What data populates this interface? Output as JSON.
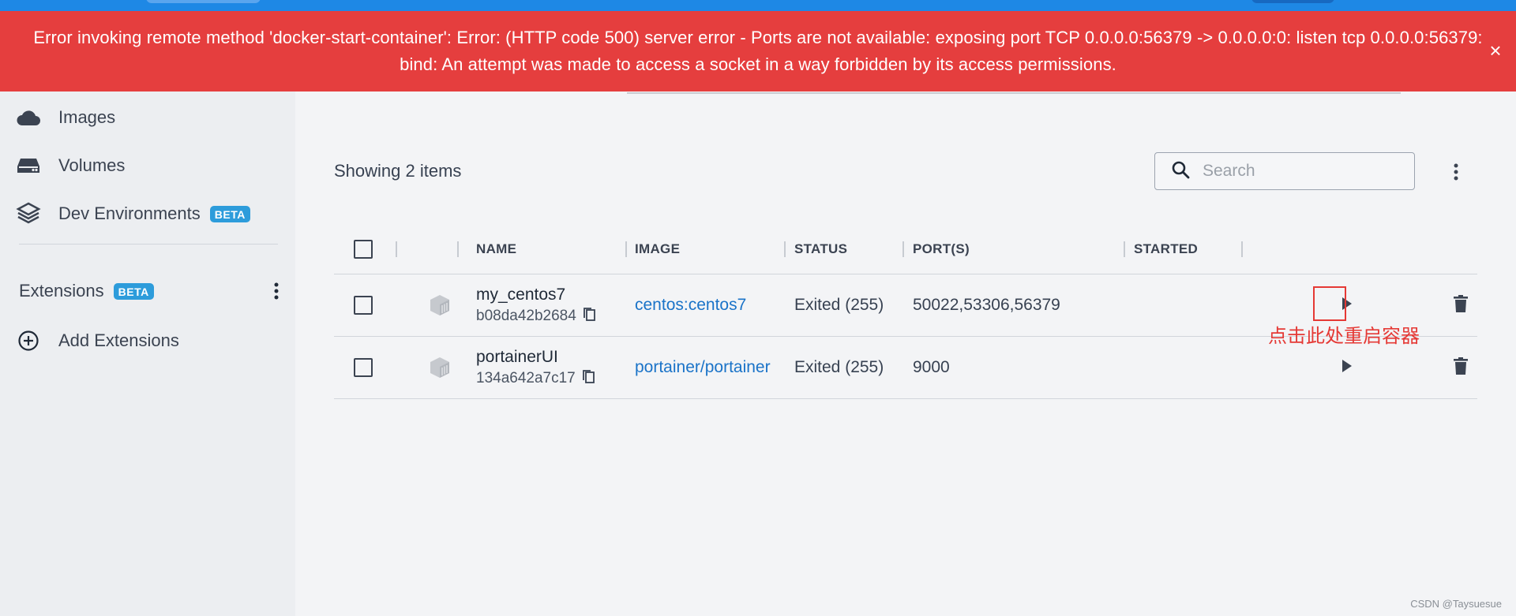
{
  "error": {
    "message": "Error invoking remote method 'docker-start-container': Error: (HTTP code 500) server error - Ports are not available: exposing port TCP 0.0.0.0:56379 -> 0.0.0.0:0: listen tcp 0.0.0.0:56379: bind: An attempt was made to access a socket in a way forbidden by its access permissions.",
    "close_label": "×"
  },
  "sidebar": {
    "items": [
      {
        "label": "Images",
        "icon": "cloud-icon"
      },
      {
        "label": "Volumes",
        "icon": "drive-icon"
      },
      {
        "label": "Dev Environments",
        "icon": "cube-stack-icon",
        "badge": "BETA"
      }
    ],
    "extensions": {
      "label": "Extensions",
      "badge": "BETA"
    },
    "add_extensions": {
      "label": "Add Extensions",
      "icon": "plus-circle-icon"
    }
  },
  "main": {
    "showing": "Showing 2 items",
    "search": {
      "placeholder": "Search"
    },
    "table": {
      "headers": [
        "NAME",
        "IMAGE",
        "STATUS",
        "PORT(S)",
        "STARTED"
      ],
      "rows": [
        {
          "name": "my_centos7",
          "id": "b08da42b2684",
          "image": "centos:centos7",
          "status": "Exited (255)",
          "ports": "50022,53306,56379",
          "started": ""
        },
        {
          "name": "portainerUI",
          "id": "134a642a7c17",
          "image": "portainer/portainer",
          "status": "Exited (255)",
          "ports": "9000",
          "started": ""
        }
      ]
    }
  },
  "annotation": {
    "text": "点击此处重启容器",
    "color": "#e53935"
  },
  "watermark": "CSDN @Taysuesue",
  "colors": {
    "error": "#e53e3e",
    "accent": "#1e88e5",
    "badge": "#2d9cdb",
    "link": "#1a73c8"
  }
}
